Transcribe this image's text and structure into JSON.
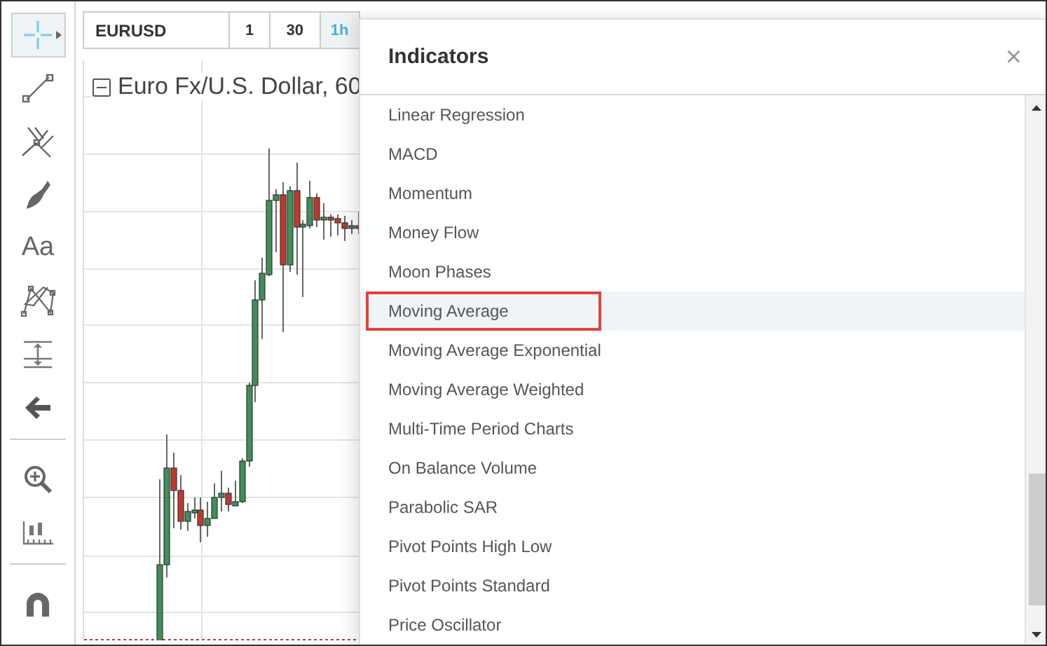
{
  "tools": [
    {
      "kind": "crosshair",
      "selected": true
    },
    {
      "kind": "line",
      "selected": false
    },
    {
      "kind": "pitchfork",
      "selected": false
    },
    {
      "kind": "brush",
      "selected": false
    },
    {
      "kind": "text",
      "label": "Aa",
      "selected": false
    },
    {
      "kind": "pattern",
      "selected": false
    },
    {
      "kind": "measure",
      "selected": false
    },
    {
      "kind": "back",
      "selected": false
    },
    {
      "kind": "divider"
    },
    {
      "kind": "zoom",
      "selected": false
    },
    {
      "kind": "ruler",
      "selected": false
    },
    {
      "kind": "divider"
    },
    {
      "kind": "magnet",
      "selected": false
    }
  ],
  "toolbar": {
    "symbol": "EURUSD",
    "intervals": [
      {
        "label": "1",
        "selected": false
      },
      {
        "label": "30",
        "selected": false
      },
      {
        "label": "1h",
        "selected": true
      }
    ]
  },
  "chart": {
    "title": "Euro Fx/U.S. Dollar, 60"
  },
  "dialog": {
    "title": "Indicators",
    "close": "×",
    "items": [
      {
        "label": "Linear Regression",
        "selected": false
      },
      {
        "label": "MACD",
        "selected": false
      },
      {
        "label": "Momentum",
        "selected": false
      },
      {
        "label": "Money Flow",
        "selected": false
      },
      {
        "label": "Moon Phases",
        "selected": false
      },
      {
        "label": "Moving Average",
        "selected": true
      },
      {
        "label": "Moving Average Exponential",
        "selected": false
      },
      {
        "label": "Moving Average Weighted",
        "selected": false
      },
      {
        "label": "Multi-Time Period Charts",
        "selected": false
      },
      {
        "label": "On Balance Volume",
        "selected": false
      },
      {
        "label": "Parabolic SAR",
        "selected": false
      },
      {
        "label": "Pivot Points High Low",
        "selected": false
      },
      {
        "label": "Pivot Points Standard",
        "selected": false
      },
      {
        "label": "Price Oscillator",
        "selected": false
      }
    ]
  }
}
